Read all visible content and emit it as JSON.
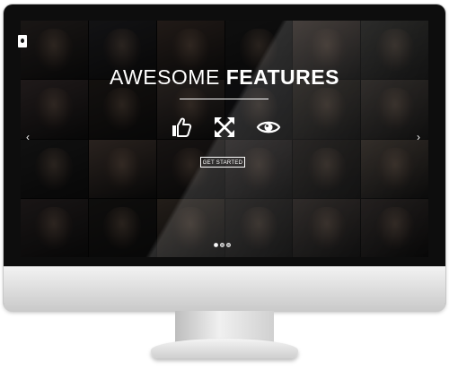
{
  "hero": {
    "title_light": "AWESOME",
    "title_bold": "FEATURES",
    "cta_label": "GET STARTED"
  },
  "icons": [
    "logo-icon",
    "thumbs-up-icon",
    "expand-arrows-icon",
    "eye-icon",
    "chevron-left-icon",
    "chevron-right-icon"
  ],
  "slider": {
    "slide_count": 3,
    "active_index": 0
  },
  "colors": {
    "text": "#ffffff",
    "screen_bezel": "#0d0d0d",
    "overlay": "#000000"
  }
}
